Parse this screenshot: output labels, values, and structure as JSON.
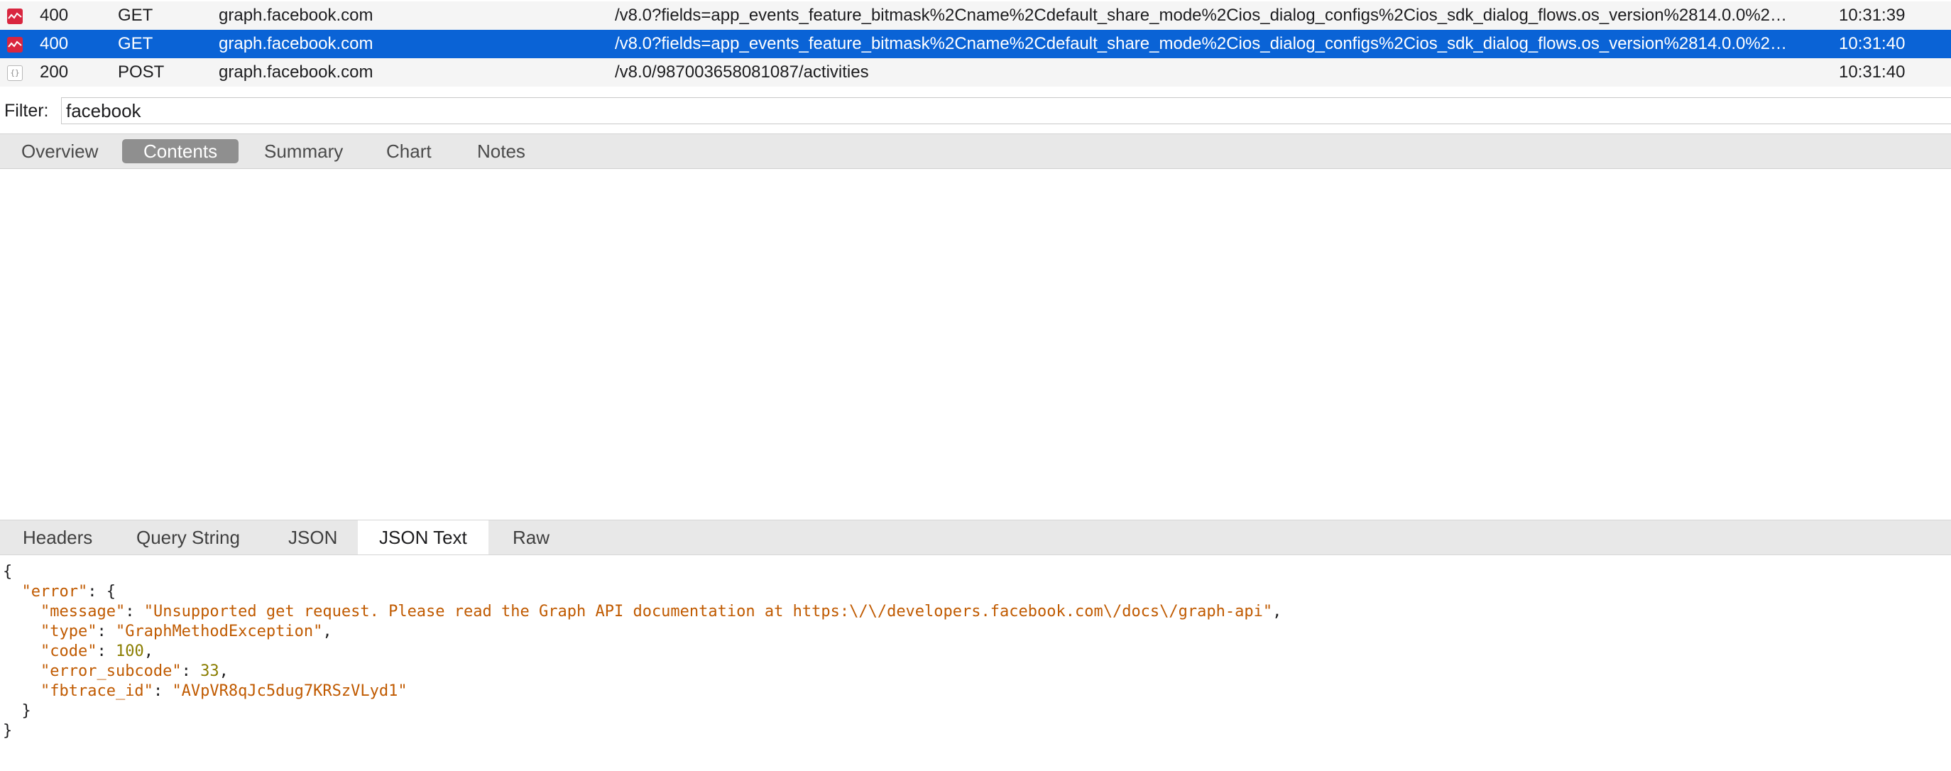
{
  "requests": [
    {
      "icon": "error-icon",
      "code": "400",
      "method": "GET",
      "host": "graph.facebook.com",
      "path": "/v8.0?fields=app_events_feature_bitmask%2Cname%2Cdefault_share_mode%2Cios_dialog_configs%2Cios_sdk_dialog_flows.os_version%2814.0.0%2…",
      "time": "10:31:39",
      "selected": false
    },
    {
      "icon": "error-icon",
      "code": "400",
      "method": "GET",
      "host": "graph.facebook.com",
      "path": "/v8.0?fields=app_events_feature_bitmask%2Cname%2Cdefault_share_mode%2Cios_dialog_configs%2Cios_sdk_dialog_flows.os_version%2814.0.0%2…",
      "time": "10:31:40",
      "selected": true
    },
    {
      "icon": "json-file-icon",
      "code": "200",
      "method": "POST",
      "host": "graph.facebook.com",
      "path": "/v8.0/987003658081087/activities",
      "time": "10:31:40",
      "selected": false
    }
  ],
  "filter": {
    "label": "Filter:",
    "value": "facebook"
  },
  "top_tabs": {
    "items": [
      "Overview",
      "Contents",
      "Summary",
      "Chart",
      "Notes"
    ],
    "active": "Contents"
  },
  "bottom_tabs": {
    "items": [
      "Headers",
      "Query String",
      "JSON",
      "JSON Text",
      "Raw"
    ],
    "active": "JSON Text"
  },
  "json_text": {
    "open_brace": "{",
    "error_key": "\"error\"",
    "error_open": ": {",
    "fields": [
      {
        "key": "\"message\"",
        "value": "\"Unsupported get request. Please read the Graph API documentation at https:\\/\\/developers.facebook.com\\/docs\\/graph-api\"",
        "type": "string",
        "trail": ","
      },
      {
        "key": "\"type\"",
        "value": "\"GraphMethodException\"",
        "type": "string",
        "trail": ","
      },
      {
        "key": "\"code\"",
        "value": "100",
        "type": "number",
        "trail": ","
      },
      {
        "key": "\"error_subcode\"",
        "value": "33",
        "type": "number",
        "trail": ","
      },
      {
        "key": "\"fbtrace_id\"",
        "value": "\"AVpVR8qJc5dug7KRSzVLyd1\"",
        "type": "string",
        "trail": ""
      }
    ],
    "inner_close": "}",
    "close_brace": "}"
  },
  "colors": {
    "selection": "#0a63d6",
    "error_icon": "#d9263f",
    "json_string": "#c05a00",
    "json_number": "#8a7d00",
    "active_top_tab": "#8f8f8f"
  }
}
